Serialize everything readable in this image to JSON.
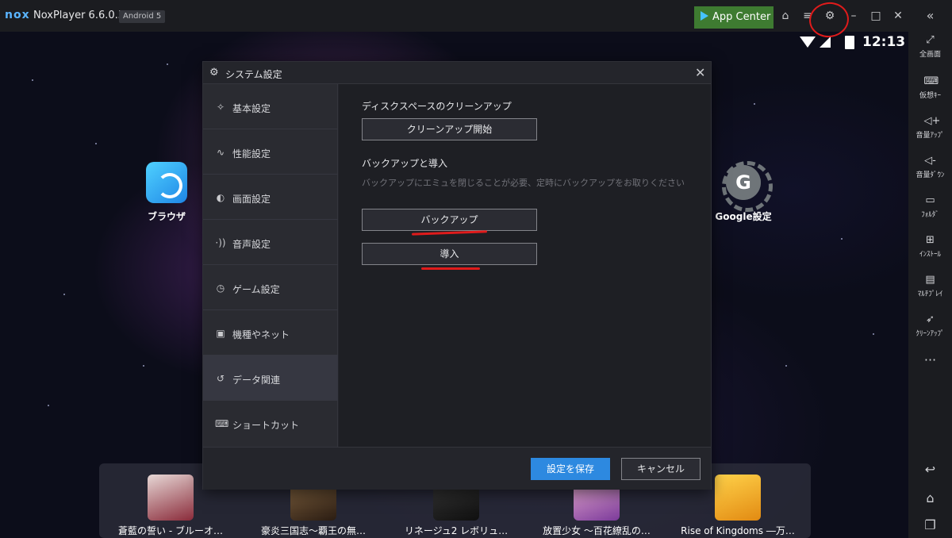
{
  "titlebar": {
    "logo": "nox",
    "app_title": "NoxPlayer 6.6.0.5",
    "android_badge": "Android 5",
    "app_center_label": "App Center"
  },
  "status": {
    "time": "12:13"
  },
  "sidebar": {
    "items": [
      {
        "icon": "fullscreen-icon",
        "label": "全画面"
      },
      {
        "icon": "keyboard-icon",
        "label": "仮想ｷｰ"
      },
      {
        "icon": "volume-up-icon",
        "label": "音量ｱｯﾌﾟ"
      },
      {
        "icon": "volume-down-icon",
        "label": "音量ﾀﾞｳﾝ"
      },
      {
        "icon": "folder-icon",
        "label": "ﾌｫﾙﾀﾞ"
      },
      {
        "icon": "install-icon",
        "label": "ｲﾝｽﾄｰﾙ"
      },
      {
        "icon": "multi-instance-icon",
        "label": "ﾏﾙﾁﾌﾟﾚｲ"
      },
      {
        "icon": "cleanup-icon",
        "label": "ｸﾘｰﾝｱｯﾌﾟ"
      }
    ]
  },
  "desktop": {
    "icons": [
      {
        "label": "ブラウザ"
      },
      {
        "label": "Google設定"
      }
    ],
    "dock": [
      {
        "label": "蒼藍の誓い - ブルーオ…"
      },
      {
        "label": "豪炎三国志〜覇王の無…"
      },
      {
        "label": "リネージュ2 レボリュ…"
      },
      {
        "label": "放置少女 〜百花繚乱の…"
      },
      {
        "label": "Rise of Kingdoms ―万…"
      }
    ]
  },
  "dialog": {
    "title": "システム設定",
    "menu": [
      {
        "label": "基本設定",
        "active": false
      },
      {
        "label": "性能設定",
        "active": false
      },
      {
        "label": "画面設定",
        "active": false
      },
      {
        "label": "音声設定",
        "active": false
      },
      {
        "label": "ゲーム設定",
        "active": false
      },
      {
        "label": "機種やネット",
        "active": false
      },
      {
        "label": "データ関連",
        "active": true
      },
      {
        "label": "ショートカット",
        "active": false
      }
    ],
    "cleanup_title": "ディスクスペースのクリーンアップ",
    "cleanup_button": "クリーンアップ開始",
    "backup_title": "バックアップと導入",
    "backup_note": "バックアップにエミュを閉じることが必要、定時にバックアップをお取りください",
    "backup_button": "バックアップ",
    "import_button": "導入",
    "save_button": "設定を保存",
    "cancel_button": "キャンセル"
  },
  "colors": {
    "accent": "#2d89e0",
    "annotation": "#e01b1b",
    "app_center": "#3e7b31"
  }
}
